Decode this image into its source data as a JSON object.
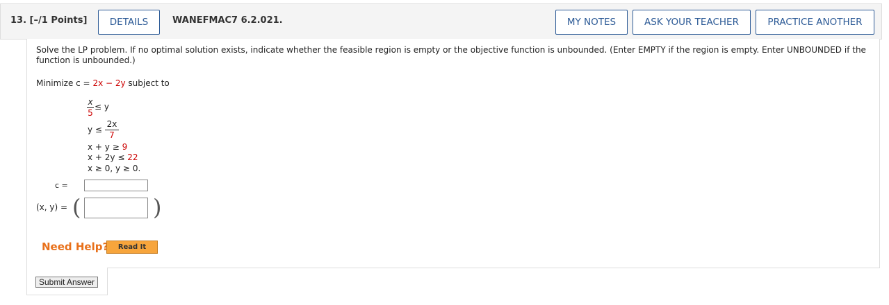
{
  "header": {
    "question_label": "13.  [–/1 Points]",
    "details_label": "DETAILS",
    "assignment_id": "WANEFMAC7 6.2.021.",
    "my_notes_label": "MY NOTES",
    "ask_teacher_label": "ASK YOUR TEACHER",
    "practice_another_label": "PRACTICE ANOTHER"
  },
  "problem": {
    "instructions_line1": "Solve the LP problem. If no optimal solution exists, indicate whether the feasible region is empty or the objective function is unbounded. (Enter EMPTY if the region is empty. Enter UNBOUNDED if the",
    "instructions_line2": "function is unbounded.)",
    "objective_prefix": "Minimize c = ",
    "objective_expr": "2x − 2y",
    "objective_suffix": " subject to",
    "c1_num": "x",
    "c1_den": "5",
    "c1_rel": " ≤ y",
    "c2_lhs": "y ≤ ",
    "c2_num": "2x",
    "c2_den": "7",
    "c3_lhs": "x + y ≥ ",
    "c3_rhs": "9",
    "c4_lhs": "x + 2y ≤ ",
    "c4_rhs": "22",
    "c5": "x ≥ 0, y ≥ 0."
  },
  "answers": {
    "c_label": "c =",
    "xy_label": "(x, y)  =",
    "c_value": "",
    "xy_value": ""
  },
  "help": {
    "need_help_label": "Need Help?",
    "read_it_label": "Read It"
  },
  "submit_label": "Submit Answer",
  "colors": {
    "accent": "#2c5a96",
    "highlight": "#cc0000",
    "help": "#e8701a",
    "read_it_bg": "#f7a53c"
  }
}
